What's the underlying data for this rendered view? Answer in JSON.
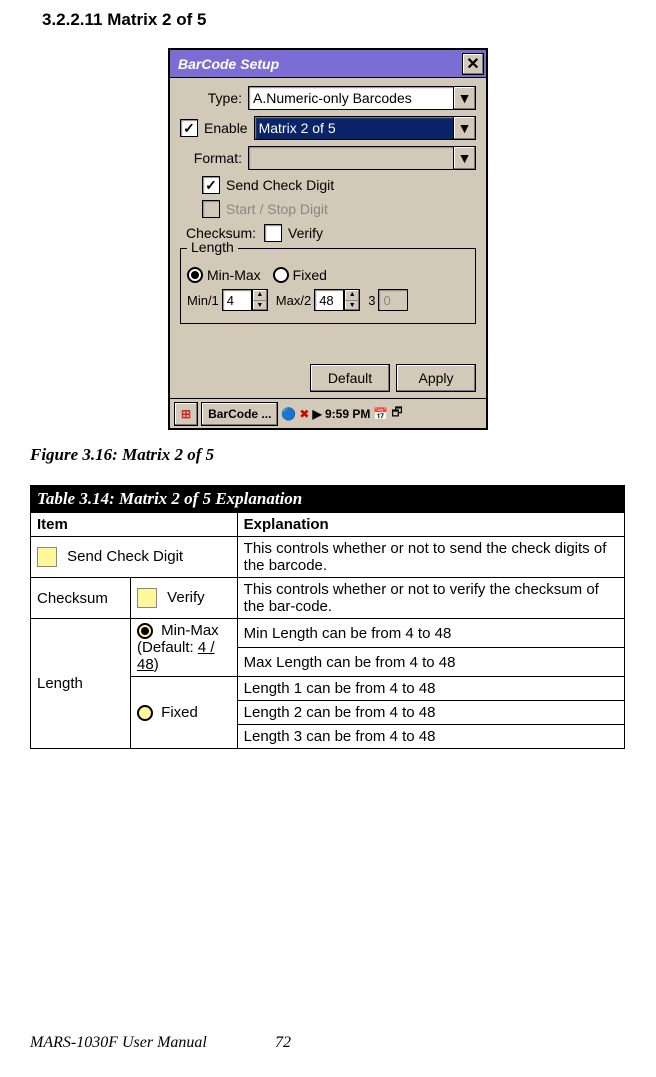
{
  "heading": "3.2.2.11 Matrix 2 of 5",
  "window": {
    "title": "BarCode Setup",
    "typeLabel": "Type:",
    "typeValue": "A.Numeric-only Barcodes",
    "enableLabel": "Enable",
    "enableChecked": "✓",
    "enableValue": "Matrix 2 of 5",
    "formatLabel": "Format:",
    "sendCheckChecked": "✓",
    "sendCheckLabel": "Send Check Digit",
    "startStopLabel": "Start / Stop Digit",
    "checksumLabel": "Checksum:",
    "verifyLabel": "Verify",
    "lengthLegend": "Length",
    "minmaxLabel": "Min-Max",
    "fixedLabel": "Fixed",
    "min1Label": "Min/1",
    "min1Value": "4",
    "max2Label": "Max/2",
    "max2Value": "48",
    "threeLabel": "3",
    "threeValue": "0",
    "defaultBtn": "Default",
    "applyBtn": "Apply",
    "taskbarApp": "BarCode ...",
    "taskbarTime": "9:59 PM"
  },
  "figureCaption": "Figure 3.16:  Matrix 2 of 5",
  "table": {
    "title": "Table 3.14: Matrix 2 of 5 Explanation",
    "h1": "Item",
    "h2": "Explanation",
    "sendCheckItem": "Send Check Digit",
    "sendCheckExpl": "This controls whether or not to send the check digits of the barcode.",
    "checksumItem": "Checksum",
    "verifyItem": "Verify",
    "checksumExpl": "This controls whether or not to verify the checksum of the bar-code.",
    "lengthItem": "Length",
    "minmaxItem": "Min-Max",
    "minmaxDefault1": "(Default: ",
    "minmaxDefault2": "4 / 48",
    "minmaxDefault3": ")",
    "minExpl": "Min Length can be from 4 to 48",
    "maxExpl": "Max Length can be from 4 to 48",
    "fixedItem": "Fixed",
    "len1": "Length 1 can be from 4 to 48",
    "len2": "Length 2 can be from 4 to 48",
    "len3": "Length 3 can be from 4 to 48"
  },
  "footer": "MARS-1030F User Manual",
  "page": "72"
}
